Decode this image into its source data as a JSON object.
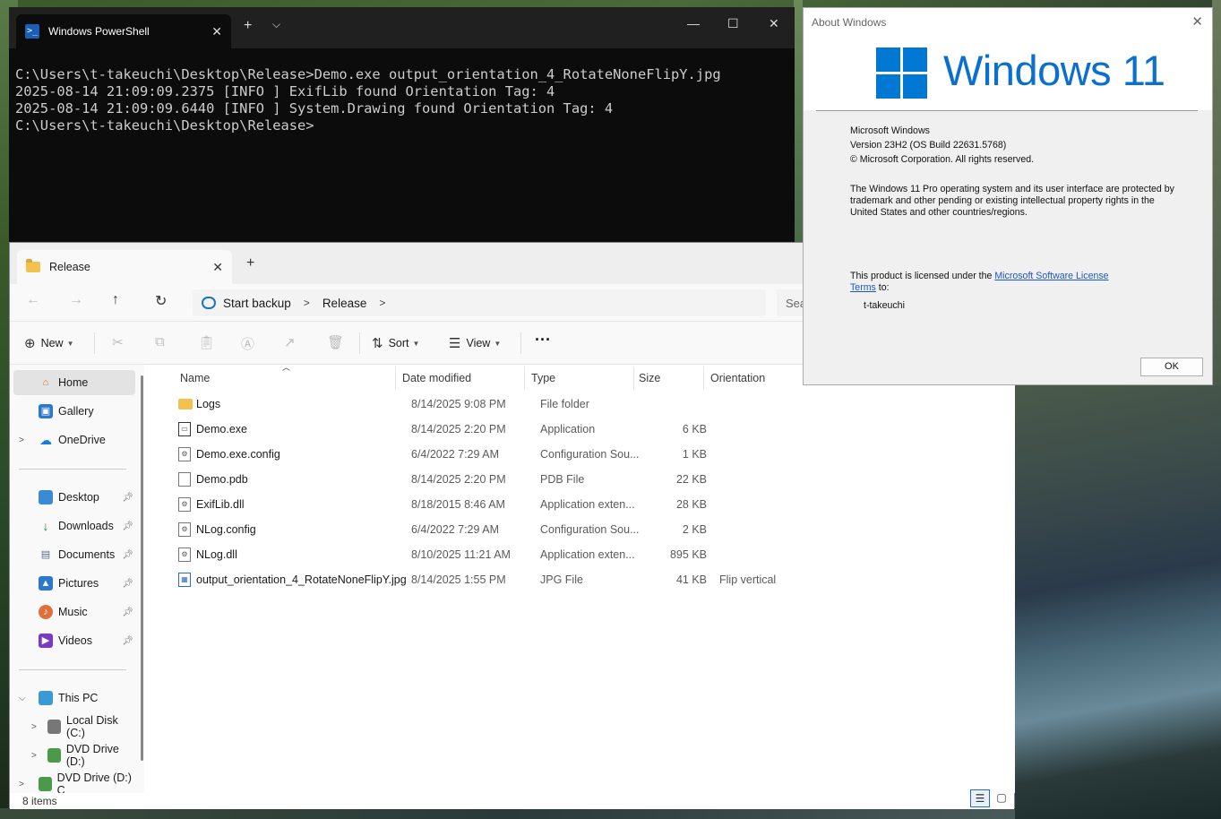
{
  "powershell": {
    "tab_title": "Windows PowerShell",
    "lines": [
      "C:\\Users\\t-takeuchi\\Desktop\\Release>Demo.exe output_orientation_4_RotateNoneFlipY.jpg",
      "2025-08-14 21:09:09.2375 [INFO ] ExifLib found Orientation Tag: 4",
      "2025-08-14 21:09:09.6440 [INFO ] System.Drawing found Orientation Tag: 4",
      "",
      "C:\\Users\\t-takeuchi\\Desktop\\Release>"
    ]
  },
  "explorer": {
    "tab_title": "Release",
    "address": {
      "backup": "Start backup",
      "folder": "Release"
    },
    "search_placeholder": "Sea",
    "toolbar": {
      "new_label": "New",
      "sort_label": "Sort",
      "view_label": "View",
      "more_label": "···"
    },
    "sidebar": {
      "home": "Home",
      "gallery": "Gallery",
      "onedrive": "OneDrive",
      "quick": [
        "Desktop",
        "Downloads",
        "Documents",
        "Pictures",
        "Music",
        "Videos"
      ],
      "thispc": "This PC",
      "localdisk": "Local Disk (C:)",
      "dvd1": "DVD Drive (D:)",
      "dvd2": "DVD Drive (D:) C"
    },
    "columns": {
      "name": "Name",
      "date": "Date modified",
      "type": "Type",
      "size": "Size",
      "orientation": "Orientation"
    },
    "files": [
      {
        "name": "Logs",
        "date": "8/14/2025 9:08 PM",
        "type": "File folder",
        "size": "",
        "orientation": ""
      },
      {
        "name": "Demo.exe",
        "date": "8/14/2025 2:20 PM",
        "type": "Application",
        "size": "6 KB",
        "orientation": ""
      },
      {
        "name": "Demo.exe.config",
        "date": "6/4/2022 7:29 AM",
        "type": "Configuration Sou...",
        "size": "1 KB",
        "orientation": ""
      },
      {
        "name": "Demo.pdb",
        "date": "8/14/2025 2:20 PM",
        "type": "PDB File",
        "size": "22 KB",
        "orientation": ""
      },
      {
        "name": "ExifLib.dll",
        "date": "8/18/2015 8:46 AM",
        "type": "Application exten...",
        "size": "28 KB",
        "orientation": ""
      },
      {
        "name": "NLog.config",
        "date": "6/4/2022 7:29 AM",
        "type": "Configuration Sou...",
        "size": "2 KB",
        "orientation": ""
      },
      {
        "name": "NLog.dll",
        "date": "8/10/2025 11:21 AM",
        "type": "Application exten...",
        "size": "895 KB",
        "orientation": ""
      },
      {
        "name": "output_orientation_4_RotateNoneFlipY.jpg",
        "date": "8/14/2025 1:55 PM",
        "type": "JPG File",
        "size": "41 KB",
        "orientation": "Flip vertical"
      }
    ],
    "status": "8 items"
  },
  "about": {
    "title": "About Windows",
    "logo_text": "Windows 11",
    "product": "Microsoft Windows",
    "version": "Version 23H2 (OS Build 22631.5768)",
    "copyright": "© Microsoft Corporation. All rights reserved.",
    "trademark": "The Windows 11 Pro operating system and its user interface are protected by trademark and other pending or existing intellectual property rights in the United States and other countries/regions.",
    "license_prefix": "This product is licensed under the ",
    "license_link": "Microsoft Software License Terms",
    "license_suffix": " to:",
    "user": "t-takeuchi",
    "ok_label": "OK"
  }
}
